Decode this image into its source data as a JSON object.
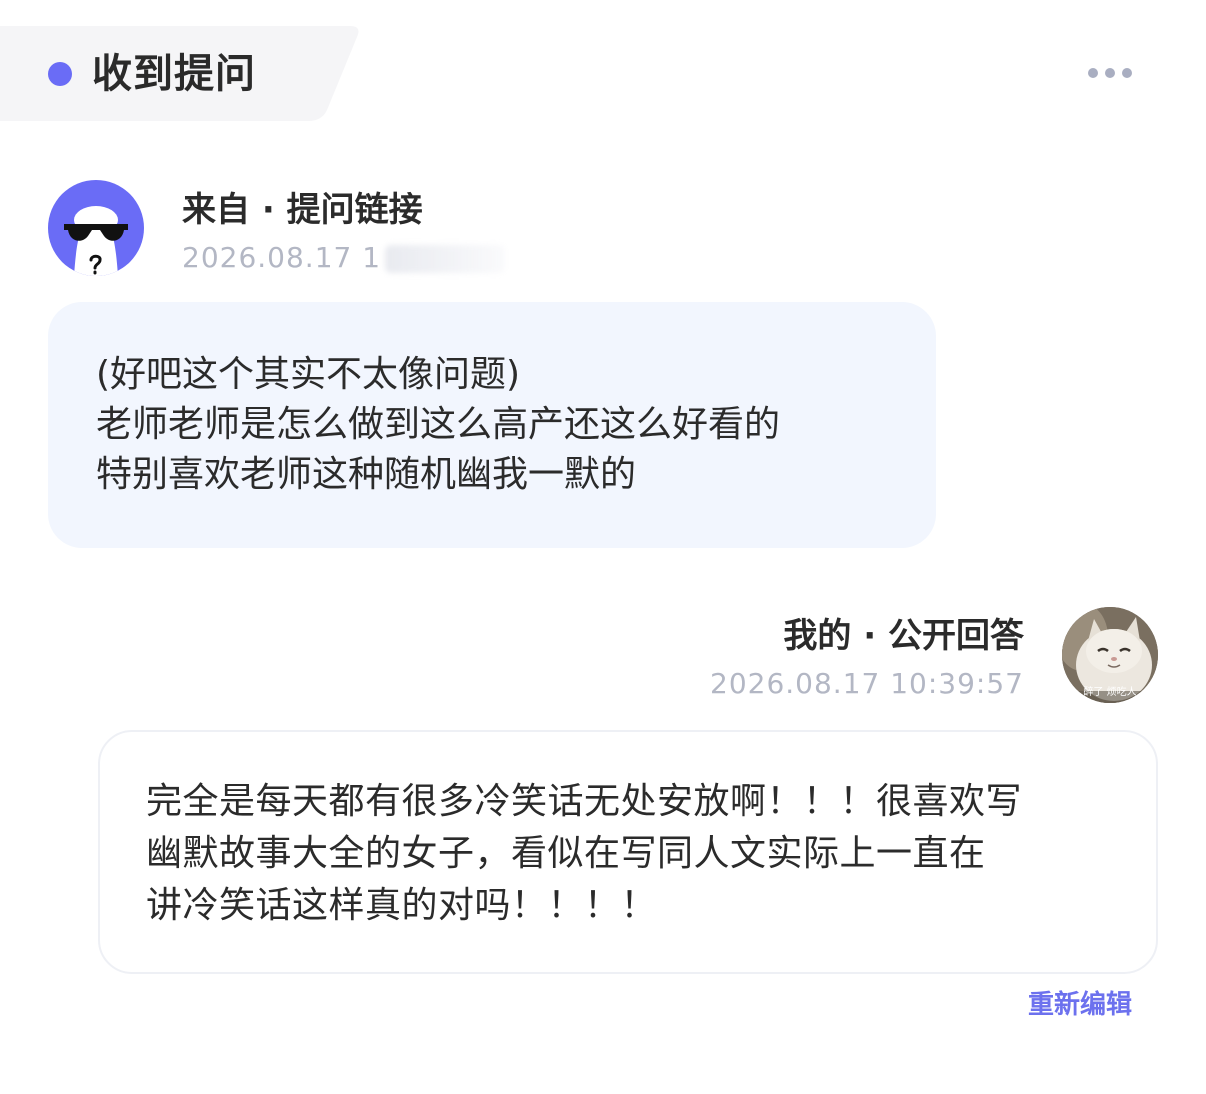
{
  "header": {
    "title": "收到提问",
    "more_icon": "more-horizontal-icon"
  },
  "question": {
    "source_label": "来自 · 提问链接",
    "timestamp": "2026.08.17 1",
    "avatar_icon": "sunglasses-ghost-avatar",
    "text": "(好吧这个其实不太像问题)\n老师老师是怎么做到这么高产还这么好看的\n特别喜欢老师这种随机幽我一默的"
  },
  "answer": {
    "label": "我的 · 公开回答",
    "timestamp": "2026.08.17 10:39:57",
    "avatar_caption": "醉了 烦吃人",
    "text": "完全是每天都有很多冷笑话无处安放啊！！！很喜欢写\n幽默故事大全的女子，看似在写同人文实际上一直在\n讲冷笑话这样真的对吗！！！！",
    "reedit_label": "重新编辑"
  },
  "colors": {
    "accent": "#6a6cf6",
    "link": "#6c71ee",
    "bubble_bg": "#f2f6fe",
    "timestamp": "#b3b7c4"
  }
}
